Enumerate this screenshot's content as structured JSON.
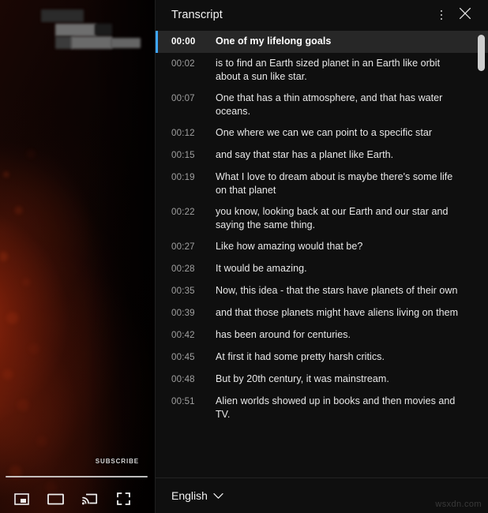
{
  "player": {
    "subscribe_label": "SUBSCRIBE",
    "progress_percent": 100,
    "controls": [
      {
        "name": "miniplayer-icon",
        "label": "Miniplayer"
      },
      {
        "name": "theater-mode-icon",
        "label": "Theater mode"
      },
      {
        "name": "cast-icon",
        "label": "Play on TV"
      },
      {
        "name": "fullscreen-icon",
        "label": "Full screen"
      }
    ]
  },
  "transcript": {
    "title": "Transcript",
    "menu_icon": "more-vertical-icon",
    "close_icon": "close-icon",
    "active_index": 0,
    "cues": [
      {
        "time": "00:00",
        "text": "One of my lifelong goals"
      },
      {
        "time": "00:02",
        "text": "is to find an Earth sized planet in an Earth like orbit about a sun like star."
      },
      {
        "time": "00:07",
        "text": "One that has a thin atmosphere, and that has water oceans."
      },
      {
        "time": "00:12",
        "text": "One where we can we can point to a specific star"
      },
      {
        "time": "00:15",
        "text": "and say that star has a planet like Earth."
      },
      {
        "time": "00:19",
        "text": "What I love to dream about is maybe there's some life on that planet"
      },
      {
        "time": "00:22",
        "text": "you know, looking back at our Earth and our star and saying the same thing."
      },
      {
        "time": "00:27",
        "text": "Like how amazing would that be?"
      },
      {
        "time": "00:28",
        "text": "It would be amazing."
      },
      {
        "time": "00:35",
        "text": "Now, this idea - that the stars have planets of their own"
      },
      {
        "time": "00:39",
        "text": "and that those planets might have aliens living on them"
      },
      {
        "time": "00:42",
        "text": "has been around for centuries."
      },
      {
        "time": "00:45",
        "text": "At first it had some pretty harsh critics."
      },
      {
        "time": "00:48",
        "text": "But by 20th century, it was mainstream."
      },
      {
        "time": "00:51",
        "text": "Alien worlds showed up in books and then movies and TV."
      }
    ],
    "footer": {
      "language": "English",
      "chevron_icon": "chevron-down-icon"
    }
  },
  "watermark": "wsxdn.com",
  "colors": {
    "accent": "#3ea6ff",
    "panel_bg": "#0f0f0f",
    "active_row_bg": "#272727",
    "text_primary": "#f1f1f1",
    "text_secondary": "#a0a0a0"
  }
}
